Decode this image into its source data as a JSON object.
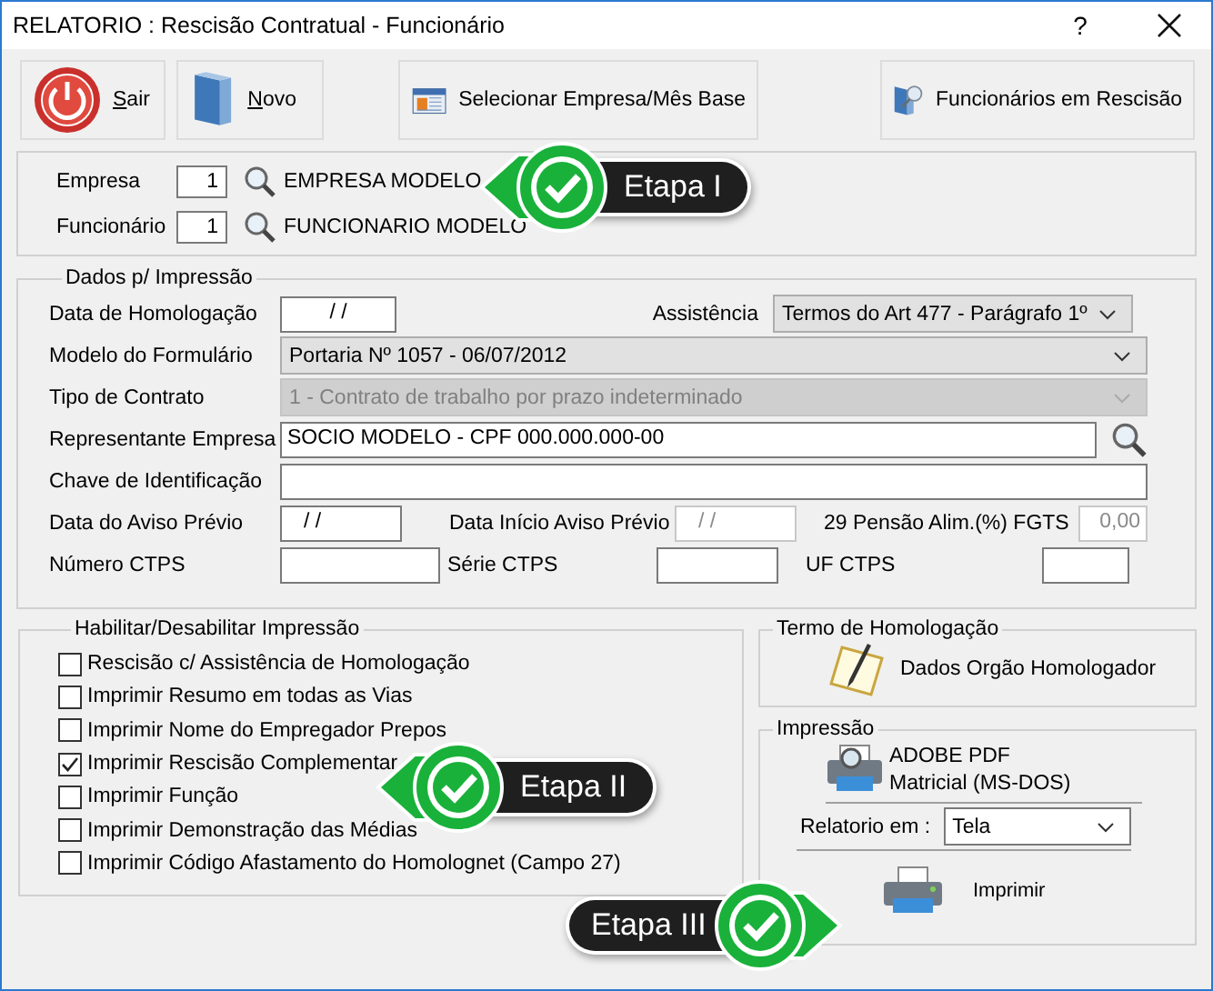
{
  "window": {
    "title": "RELATORIO : Rescisão Contratual - Funcionário",
    "help": "?"
  },
  "toolbar": [
    {
      "label": "Sair",
      "kind": "power",
      "mnemonic": true
    },
    {
      "label": "Novo",
      "kind": "book",
      "mnemonic": true
    },
    {
      "label": "Selecionar Empresa/Mês Base",
      "kind": "calendar",
      "mnemonic": false
    },
    {
      "label": "Funcionários em Rescisão",
      "kind": "book-search",
      "mnemonic": false
    }
  ],
  "selection": [
    {
      "label": "Empresa",
      "code": "1",
      "name": "EMPRESA MODELO"
    },
    {
      "label": "Funcionário",
      "code": "1",
      "name": "FUNCIONARIO MODELO"
    }
  ],
  "dados": {
    "title": "Dados p/ Impressão",
    "data_homologacao": {
      "label": "Data de Homologação",
      "value": "/ /"
    },
    "assistencia": {
      "label": "Assistência",
      "value": "Termos do Art 477 - Parágrafo 1º"
    },
    "modelo": {
      "label": "Modelo do Formulário",
      "value": "Portaria Nº 1057 - 06/07/2012"
    },
    "tipo_contrato": {
      "label": "Tipo de Contrato",
      "value": "1 - Contrato de trabalho por prazo indeterminado",
      "disabled": true
    },
    "representante": {
      "label": "Representante Empresa",
      "value": "SOCIO MODELO - CPF 000.000.000-00"
    },
    "chave": {
      "label": "Chave de Identificação"
    },
    "aviso_previo": {
      "label": "Data do Aviso Prévio",
      "value": "/ /"
    },
    "inicio_aviso": {
      "label": "Data Início Aviso Prévio",
      "value": "/ /",
      "disabled": true
    },
    "pensao": {
      "label": "29 Pensão Alim.(%) FGTS",
      "value": "0,00",
      "disabled": true
    },
    "numero_ctps": {
      "label": "Número CTPS"
    },
    "serie_ctps": {
      "label": "Série CTPS"
    },
    "uf_ctps": {
      "label": "UF CTPS"
    }
  },
  "habilitar": {
    "title": "Habilitar/Desabilitar Impressão",
    "options": [
      {
        "label": "Rescisão c/ Assistência de Homologação",
        "checked": false
      },
      {
        "label": "Imprimir Resumo em todas as Vias",
        "checked": false
      },
      {
        "label": "Imprimir Nome do Empregador Prepos",
        "checked": false
      },
      {
        "label": "Imprimir Rescisão Complementar",
        "checked": true
      },
      {
        "label": "Imprimir Função",
        "checked": false
      },
      {
        "label": "Imprimir Demonstração das Médias",
        "checked": false
      },
      {
        "label": "Imprimir Código Afastamento do Homolognet (Campo 27)",
        "checked": false
      }
    ]
  },
  "termo": {
    "title": "Termo de Homologação",
    "button": "Dados Orgão Homologador"
  },
  "impressao": {
    "title": "Impressão",
    "printers": [
      "ADOBE PDF",
      "Matricial (MS-DOS)"
    ],
    "output_label": "Relatorio em :",
    "output_value": "Tela",
    "print_button": "Imprimir"
  },
  "callouts": [
    {
      "label": "Etapa I",
      "kind": "left"
    },
    {
      "label": "Etapa II",
      "kind": "left"
    },
    {
      "label": "Etapa III",
      "kind": "right"
    }
  ]
}
